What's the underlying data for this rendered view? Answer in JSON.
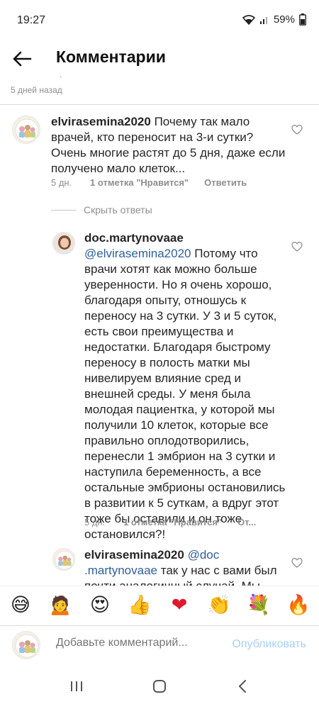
{
  "status": {
    "time": "19:27",
    "battery": "59%"
  },
  "header": {
    "title": "Комментарии"
  },
  "previous": {
    "time": "5 дней назад",
    "dot": "."
  },
  "comments": [
    {
      "user": "elvirasemina2020",
      "text": "Почему так мало врачей, кто переносит на 3-и сутки? Очень многие растят до 5 дня, даже если получено мало клеток...",
      "time": "5 дн.",
      "likes": "1 отметка \"Нравится\"",
      "reply": "Ответить"
    }
  ],
  "hide_replies": "Скрыть ответы",
  "replies": [
    {
      "user": "doc.martynovaae",
      "mention": "@elvirasemina2020",
      "text": "Потому что врачи хотят как можно больше уверенности. Но я очень хорошо, благодаря опыту, отношусь к переносу на 3 сутки. У 3 и 5 суток, есть свои преимущества и недостатки. Благодаря быстрому переносу в полость матки мы нивелируем влияние сред и внешней среды. У меня была молодая пациентка, у которой мы получили 10 клеток, которые все правильно оплодотворились, перенесли 1 эмбрион на 3 сутки и наступила беременность, а все остальные эмбрионы остановились в развитии к 5 суткам, а вдруг этот тоже бы оставили и он тоже остановился?!",
      "time": "5 дн.",
      "likes": "1 отметка \"Нравится\"",
      "reply": "От..."
    },
    {
      "user": "elvirasemina2020",
      "mention_line1": "@doc",
      "mention_line2": ".martynovaae",
      "text": "так у нас с вами был почти аналогичный случай. Мы"
    }
  ],
  "emoji_bar": [
    {
      "name": "grinning-sweat-emoji",
      "glyph": "😅"
    },
    {
      "name": "person-emoji",
      "glyph": "🙍"
    },
    {
      "name": "heart-eyes-emoji",
      "glyph": "😍"
    },
    {
      "name": "thumbs-up-emoji",
      "glyph": "👍"
    },
    {
      "name": "red-heart-emoji",
      "glyph": "❤"
    },
    {
      "name": "clapping-hands-emoji",
      "glyph": "👏"
    },
    {
      "name": "bouquet-emoji",
      "glyph": "💐"
    },
    {
      "name": "fire-emoji",
      "glyph": "🔥"
    }
  ],
  "composer": {
    "placeholder": "Добавьте комментарий...",
    "publish": "Опубликовать"
  },
  "colors": {
    "mention": "#2f5f9a",
    "muted": "#8e8e8e",
    "publish_disabled": "#a6cff5"
  }
}
